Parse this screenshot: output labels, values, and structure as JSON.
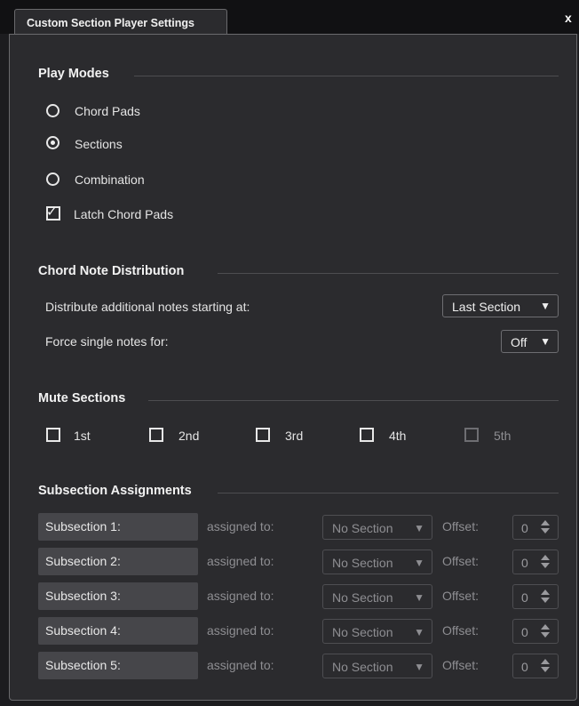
{
  "window": {
    "tab_title": "Custom Section Player Settings",
    "close_label": "x"
  },
  "play_modes": {
    "title": "Play Modes",
    "options": [
      {
        "label": "Chord Pads",
        "selected": false
      },
      {
        "label": "Sections",
        "selected": true
      },
      {
        "label": "Combination",
        "selected": false
      }
    ],
    "latch": {
      "label": "Latch Chord Pads",
      "checked": true
    }
  },
  "chord_note_distribution": {
    "title": "Chord Note Distribution",
    "distribute": {
      "label": "Distribute additional notes starting at:",
      "value": "Last Section"
    },
    "force_single": {
      "label": "Force single notes for:",
      "value": "Off"
    }
  },
  "mute_sections": {
    "title": "Mute Sections",
    "items": [
      {
        "label": "1st",
        "checked": false,
        "enabled": true
      },
      {
        "label": "2nd",
        "checked": false,
        "enabled": true
      },
      {
        "label": "3rd",
        "checked": false,
        "enabled": true
      },
      {
        "label": "4th",
        "checked": false,
        "enabled": true
      },
      {
        "label": "5th",
        "checked": false,
        "enabled": false
      }
    ]
  },
  "subsection_assignments": {
    "title": "Subsection Assignments",
    "assigned_label": "assigned to:",
    "offset_label": "Offset:",
    "rows": [
      {
        "name": "Subsection 1:",
        "section": "No Section",
        "offset": "0"
      },
      {
        "name": "Subsection 2:",
        "section": "No Section",
        "offset": "0"
      },
      {
        "name": "Subsection 3:",
        "section": "No Section",
        "offset": "0"
      },
      {
        "name": "Subsection 4:",
        "section": "No Section",
        "offset": "0"
      },
      {
        "name": "Subsection 5:",
        "section": "No Section",
        "offset": "0"
      }
    ]
  },
  "icons": {
    "dropdown": "triangle-down-icon",
    "spinner": "up-down-arrows-icon",
    "check": "checkmark-icon"
  }
}
